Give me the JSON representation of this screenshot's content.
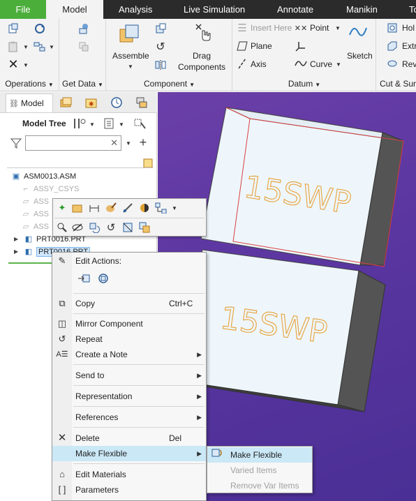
{
  "tabs": [
    "File",
    "Model",
    "Analysis",
    "Live Simulation",
    "Annotate",
    "Manikin",
    "To"
  ],
  "ribbon": {
    "operations_label": "Operations",
    "getdata_label": "Get Data",
    "component_label": "Component",
    "datum_label": "Datum",
    "cutsurf_label": "Cut & Sur",
    "assemble": "Assemble",
    "drag_line1": "Drag",
    "drag_line2": "Components",
    "insert_here": "Insert Here",
    "point": "Point",
    "plane": "Plane",
    "axis": "Axis",
    "curve": "Curve",
    "sketch": "Sketch",
    "hole": "Hol",
    "extrude": "Extr",
    "revolve": "Rev"
  },
  "panel": {
    "model_tab": "Model",
    "tree_title": "Model Tree",
    "search_placeholder": ""
  },
  "tree": {
    "root": "ASM0013.ASM",
    "csys": "ASSY_CSYS",
    "d1": "ASS",
    "d2": "ASS",
    "d3": "ASS",
    "part1": "PRT0016.PRT",
    "part2": "PRT0016.PRT"
  },
  "menu": {
    "edit_actions": "Edit Actions:",
    "copy": "Copy",
    "copy_sc": "Ctrl+C",
    "mirror": "Mirror Component",
    "repeat": "Repeat",
    "create_note": "Create a Note",
    "send_to": "Send to",
    "representation": "Representation",
    "references": "References",
    "delete": "Delete",
    "delete_sc": "Del",
    "make_flexible": "Make Flexible",
    "edit_materials": "Edit Materials",
    "parameters": "Parameters"
  },
  "submenu": {
    "make_flexible": "Make Flexible",
    "varied_items": "Varied Items",
    "remove_var_items": "Remove Var Items"
  },
  "viewport": {
    "label_top": "15SWP",
    "label_bottom": "15SWP"
  },
  "colors": {
    "file_tab": "#4bae3a",
    "viewport_bg": "#5a36a0",
    "highlight": "#cbe8f6",
    "text_orange": "#e8a23a",
    "selection_red": "#d94040"
  }
}
